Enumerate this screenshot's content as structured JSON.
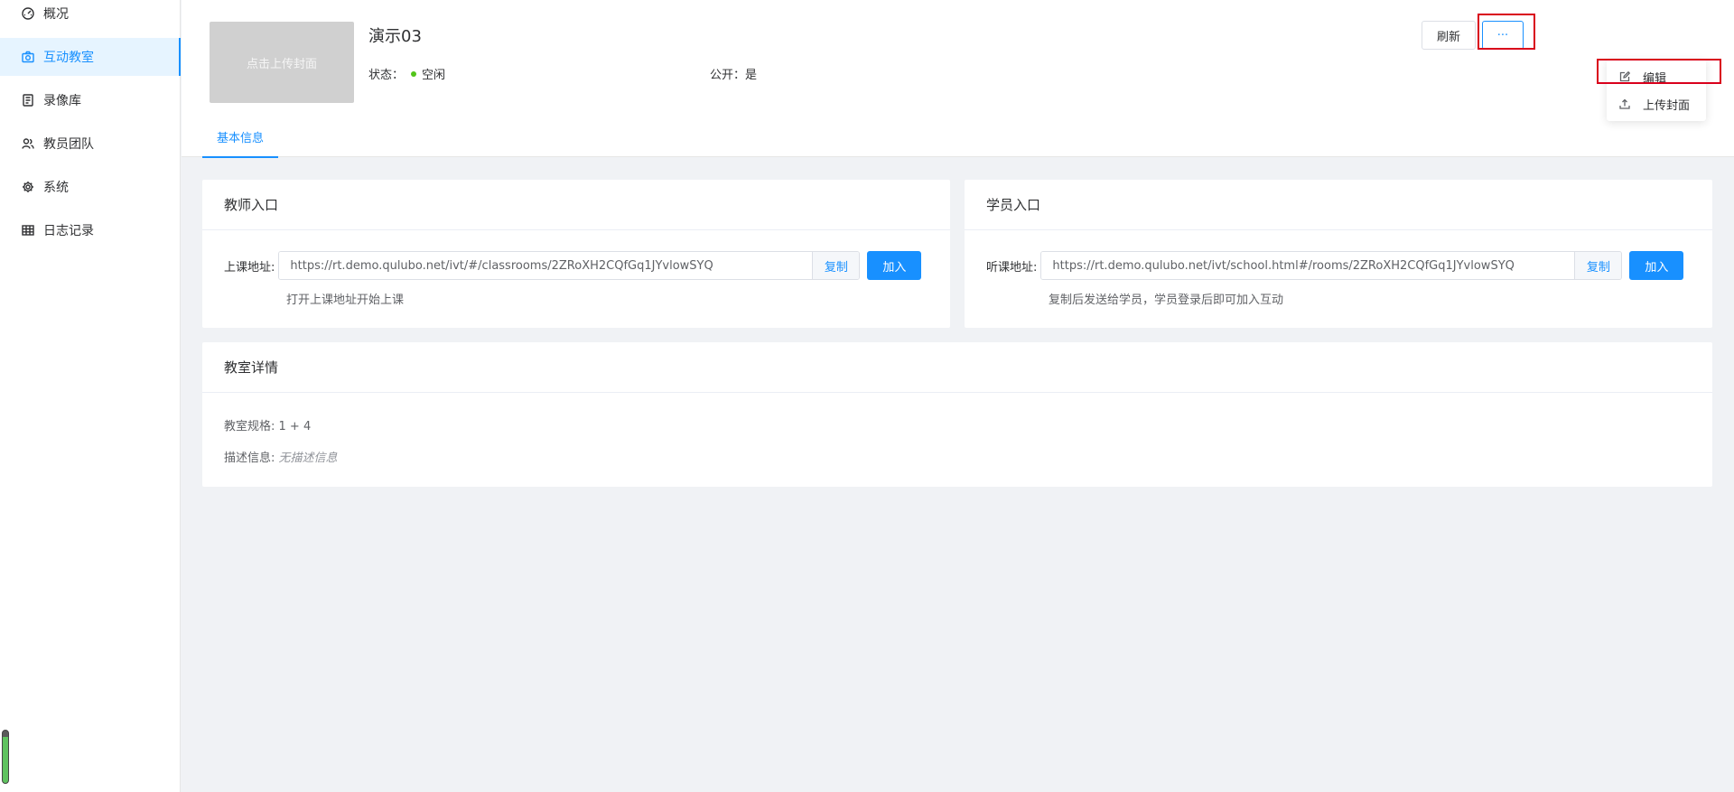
{
  "sidebar": {
    "items": [
      {
        "label": "概况",
        "icon": "dashboard-icon"
      },
      {
        "label": "互动教室",
        "icon": "camera-icon"
      },
      {
        "label": "录像库",
        "icon": "book-icon"
      },
      {
        "label": "教员团队",
        "icon": "users-icon"
      },
      {
        "label": "系统",
        "icon": "gear-icon"
      },
      {
        "label": "日志记录",
        "icon": "table-icon"
      }
    ],
    "active_index": 1
  },
  "header": {
    "cover_text": "点击上传封面",
    "title": "演示03",
    "status_label": "状态：",
    "status_value": "空闲",
    "status_color": "#52c41a",
    "public_label": "公开：",
    "public_value": "是",
    "refresh_label": "刷新",
    "more_label": "···",
    "tabs": [
      {
        "label": "基本信息"
      }
    ]
  },
  "dropdown": {
    "items": [
      {
        "label": "编辑",
        "icon": "edit-icon"
      },
      {
        "label": "上传封面",
        "icon": "upload-icon"
      }
    ]
  },
  "teacher_entry": {
    "title": "教师入口",
    "url_label": "上课地址:",
    "url": "https://rt.demo.qulubo.net/ivt/#/classrooms/2ZRoXH2CQfGq1JYvlowSYQ",
    "copy_label": "复制",
    "join_label": "加入",
    "hint": "打开上课地址开始上课"
  },
  "student_entry": {
    "title": "学员入口",
    "url_label": "听课地址:",
    "url": "https://rt.demo.qulubo.net/ivt/school.html#/rooms/2ZRoXH2CQfGq1JYvlowSYQ",
    "copy_label": "复制",
    "join_label": "加入",
    "hint": "复制后发送给学员，学员登录后即可加入互动"
  },
  "classroom_details": {
    "title": "教室详情",
    "spec_label": "教室规格:",
    "spec_value": "1 + 4",
    "desc_label": "描述信息:",
    "desc_value": "无描述信息"
  },
  "colors": {
    "accent": "#1890ff",
    "highlight": "#d9001b"
  }
}
